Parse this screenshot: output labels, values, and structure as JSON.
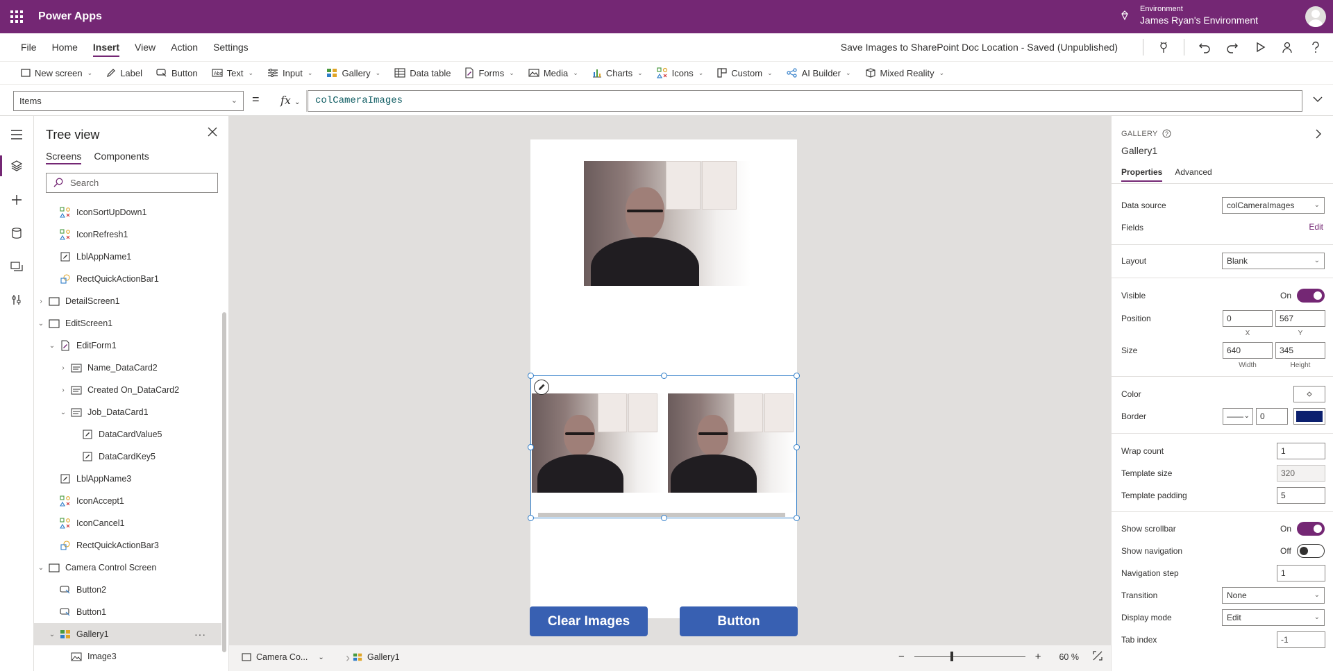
{
  "app": {
    "name": "Power Apps"
  },
  "environment": {
    "label": "Environment",
    "name": "James Ryan's Environment"
  },
  "menu": {
    "items": [
      "File",
      "Home",
      "Insert",
      "View",
      "Action",
      "Settings"
    ],
    "active": "Insert",
    "doc_title": "Save Images to SharePoint Doc Location - Saved (Unpublished)"
  },
  "ribbon": {
    "new_screen": "New screen",
    "label": "Label",
    "button": "Button",
    "text": "Text",
    "input": "Input",
    "gallery": "Gallery",
    "data_table": "Data table",
    "forms": "Forms",
    "media": "Media",
    "charts": "Charts",
    "icons": "Icons",
    "custom": "Custom",
    "ai_builder": "AI Builder",
    "mixed_reality": "Mixed Reality"
  },
  "formula": {
    "property": "Items",
    "equals": "=",
    "fx": "fx",
    "value": "colCameraImages"
  },
  "tree": {
    "title": "Tree view",
    "tabs": [
      "Screens",
      "Components"
    ],
    "search_placeholder": "Search",
    "rows": [
      {
        "label": "IconSortUpDown1",
        "level": 2,
        "icon": "icon-control-icon",
        "expand": ""
      },
      {
        "label": "IconRefresh1",
        "level": 2,
        "icon": "icon-control-icon",
        "expand": ""
      },
      {
        "label": "LblAppName1",
        "level": 2,
        "icon": "label-icon",
        "expand": ""
      },
      {
        "label": "RectQuickActionBar1",
        "level": 2,
        "icon": "shape-icon",
        "expand": ""
      },
      {
        "label": "DetailScreen1",
        "level": 1,
        "icon": "screen-icon",
        "expand": "›"
      },
      {
        "label": "EditScreen1",
        "level": 1,
        "icon": "screen-icon",
        "expand": "⌄"
      },
      {
        "label": "EditForm1",
        "level": 2,
        "icon": "form-icon",
        "expand": "⌄"
      },
      {
        "label": "Name_DataCard2",
        "level": 3,
        "icon": "datacard-icon",
        "expand": "›"
      },
      {
        "label": "Created On_DataCard2",
        "level": 3,
        "icon": "datacard-icon",
        "expand": "›"
      },
      {
        "label": "Job_DataCard1",
        "level": 3,
        "icon": "datacard-icon",
        "expand": "⌄"
      },
      {
        "label": "DataCardValue5",
        "level": 4,
        "icon": "label-icon",
        "expand": ""
      },
      {
        "label": "DataCardKey5",
        "level": 4,
        "icon": "label-icon",
        "expand": ""
      },
      {
        "label": "LblAppName3",
        "level": 2,
        "icon": "label-icon",
        "expand": ""
      },
      {
        "label": "IconAccept1",
        "level": 2,
        "icon": "icon-control-icon",
        "expand": ""
      },
      {
        "label": "IconCancel1",
        "level": 2,
        "icon": "icon-control-icon",
        "expand": ""
      },
      {
        "label": "RectQuickActionBar3",
        "level": 2,
        "icon": "shape-icon",
        "expand": ""
      },
      {
        "label": "Camera Control Screen",
        "level": 1,
        "icon": "screen-icon",
        "expand": "⌄"
      },
      {
        "label": "Button2",
        "level": 2,
        "icon": "button-icon",
        "expand": ""
      },
      {
        "label": "Button1",
        "level": 2,
        "icon": "button-icon",
        "expand": ""
      },
      {
        "label": "Gallery1",
        "level": 2,
        "icon": "gallery-icon",
        "expand": "⌄",
        "selected": true
      },
      {
        "label": "Image3",
        "level": 3,
        "icon": "image-icon",
        "expand": ""
      }
    ],
    "more": "···"
  },
  "canvas": {
    "buttons": {
      "clear": "Clear Images",
      "button": "Button"
    }
  },
  "status": {
    "screen": "Camera Co...",
    "control": "Gallery1",
    "zoom_minus": "−",
    "zoom_plus": "+",
    "zoom_value": "60",
    "zoom_unit": "%"
  },
  "properties": {
    "kind": "GALLERY",
    "name": "Gallery1",
    "tabs": [
      "Properties",
      "Advanced"
    ],
    "data_source_label": "Data source",
    "data_source_value": "colCameraImages",
    "fields_label": "Fields",
    "fields_edit": "Edit",
    "layout_label": "Layout",
    "layout_value": "Blank",
    "visible_label": "Visible",
    "visible_state": "On",
    "position_label": "Position",
    "position_x": "0",
    "position_y": "567",
    "x_label": "X",
    "y_label": "Y",
    "size_label": "Size",
    "size_w": "640",
    "size_h": "345",
    "width_label": "Width",
    "height_label": "Height",
    "color_label": "Color",
    "border_label": "Border",
    "border_style": "——",
    "border_width": "0",
    "border_color": "#0b1f6e",
    "wrap_label": "Wrap count",
    "wrap_value": "1",
    "template_size_label": "Template size",
    "template_size_value": "320",
    "template_padding_label": "Template padding",
    "template_padding_value": "5",
    "scrollbar_label": "Show scrollbar",
    "scrollbar_state": "On",
    "navigation_label": "Show navigation",
    "navigation_state": "Off",
    "nav_step_label": "Navigation step",
    "nav_step_value": "1",
    "transition_label": "Transition",
    "transition_value": "None",
    "display_mode_label": "Display mode",
    "display_mode_value": "Edit",
    "tab_index_label": "Tab index",
    "tab_index_value": "-1"
  },
  "colors": {
    "brand": "#742774",
    "button": "#3860b2",
    "selection": "#2f7dc9"
  }
}
